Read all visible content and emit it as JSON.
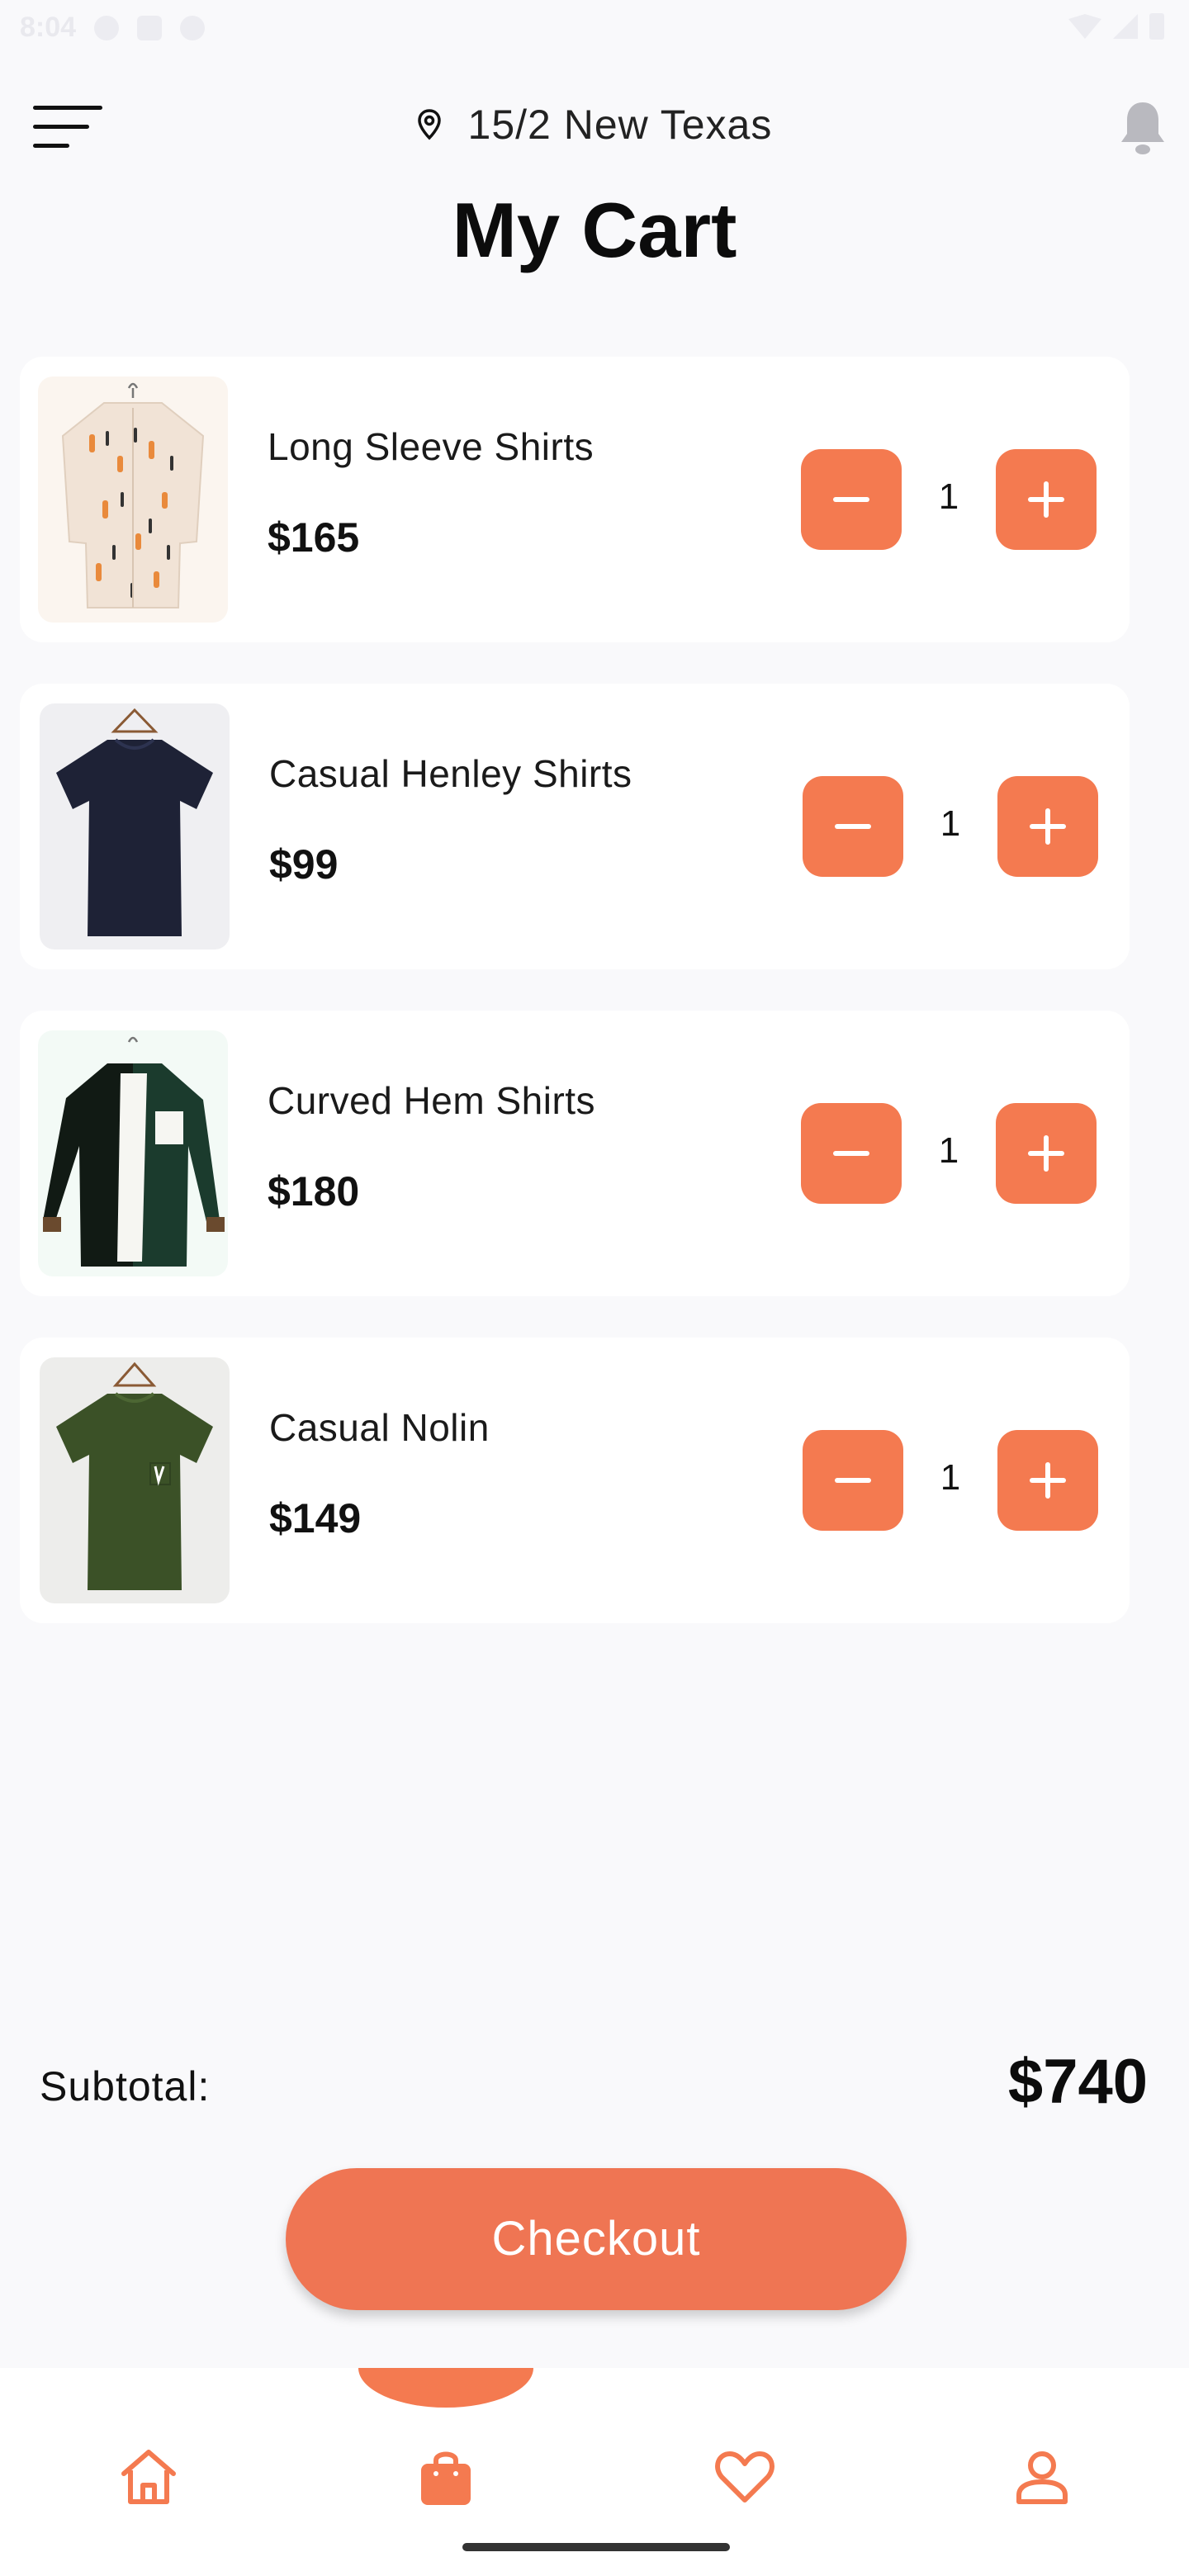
{
  "status_bar": {
    "time": "8:04"
  },
  "header": {
    "location": "15/2 New Texas",
    "title": "My Cart"
  },
  "cart": {
    "items": [
      {
        "name": "Long Sleeve Shirts",
        "price": "$165",
        "quantity": "1",
        "shirt_color": "#f1e3d6",
        "thumb_bg": "#fbf5ef"
      },
      {
        "name": "Casual Henley Shirts",
        "price": "$99",
        "quantity": "1",
        "shirt_color": "#1e2236",
        "thumb_bg": "#efeff2"
      },
      {
        "name": "Curved Hem Shirts",
        "price": "$180",
        "quantity": "1",
        "shirt_color": "#1b3b2d",
        "thumb_bg": "#f3faf6"
      },
      {
        "name": "Casual Nolin",
        "price": "$149",
        "quantity": "1",
        "shirt_color": "#3b5127",
        "thumb_bg": "#ededeb"
      }
    ]
  },
  "summary": {
    "subtotal_label": "Subtotal:",
    "subtotal_value": "$740"
  },
  "actions": {
    "checkout_label": "Checkout"
  },
  "nav": {
    "items": [
      "home-icon",
      "shopping-bag-icon",
      "heart-icon",
      "user-icon"
    ],
    "active": "shopping-bag-icon"
  },
  "colors": {
    "accent": "#f47a50",
    "checkout": "#ef7553",
    "background": "#f9f9fb",
    "card": "#ffffff"
  }
}
